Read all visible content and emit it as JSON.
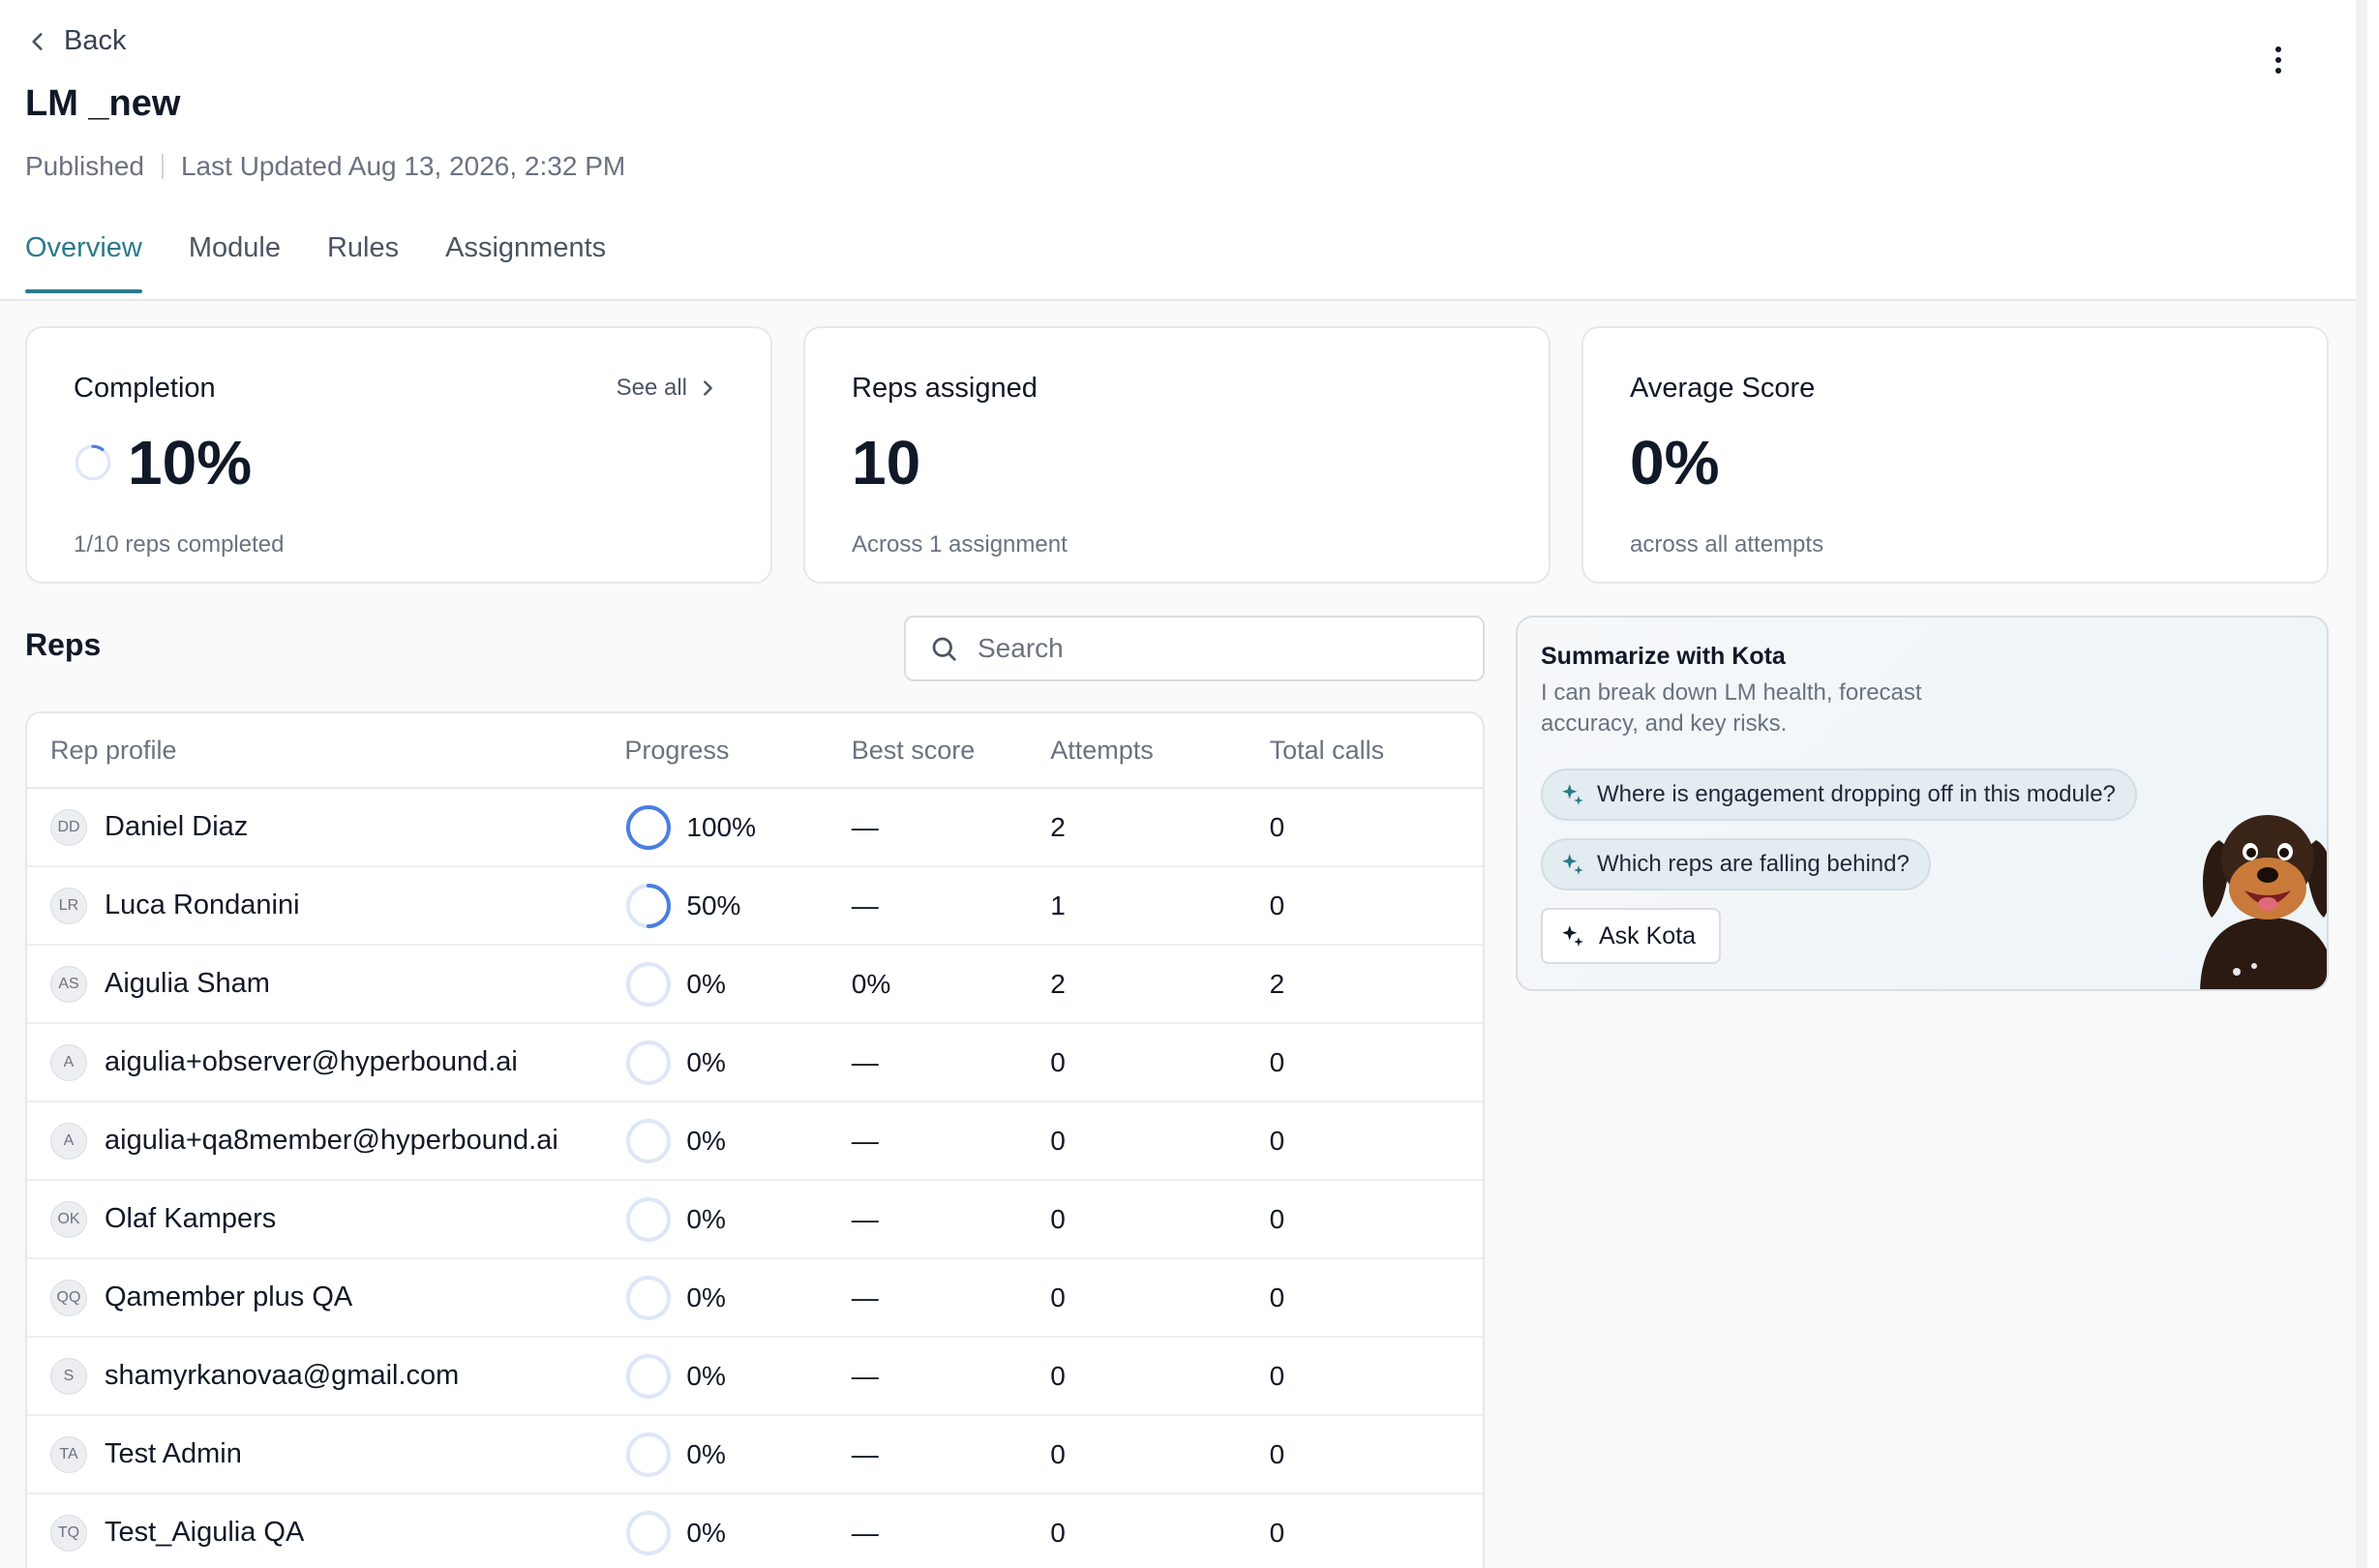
{
  "header": {
    "back_label": "Back",
    "title": "LM _new",
    "status": "Published",
    "last_updated": "Last Updated Aug 13, 2026, 2:32 PM"
  },
  "tabs": [
    {
      "label": "Overview",
      "active": true
    },
    {
      "label": "Module",
      "active": false
    },
    {
      "label": "Rules",
      "active": false
    },
    {
      "label": "Assignments",
      "active": false
    }
  ],
  "cards": {
    "completion": {
      "title": "Completion",
      "see_all": "See all",
      "value": "10%",
      "fraction": 0.1,
      "sub": "1/10 reps completed"
    },
    "reps_assigned": {
      "title": "Reps assigned",
      "value": "10",
      "sub": "Across 1 assignment"
    },
    "average_score": {
      "title": "Average Score",
      "value": "0%",
      "sub": "across all attempts"
    }
  },
  "reps": {
    "title": "Reps",
    "search_placeholder": "Search",
    "columns": [
      "Rep profile",
      "Progress",
      "Best score",
      "Attempts",
      "Total calls"
    ],
    "rows": [
      {
        "initials": "DD",
        "name": "Daniel Diaz",
        "progress": "100%",
        "progress_fraction": 1.0,
        "best_score": "—",
        "attempts": "2",
        "total_calls": "0"
      },
      {
        "initials": "LR",
        "name": "Luca Rondanini",
        "progress": "50%",
        "progress_fraction": 0.5,
        "best_score": "—",
        "attempts": "1",
        "total_calls": "0"
      },
      {
        "initials": "AS",
        "name": "Aigulia Sham",
        "progress": "0%",
        "progress_fraction": 0,
        "best_score": "0%",
        "attempts": "2",
        "total_calls": "2"
      },
      {
        "initials": "A",
        "name": "aigulia+observer@hyperbound.ai",
        "progress": "0%",
        "progress_fraction": 0,
        "best_score": "—",
        "attempts": "0",
        "total_calls": "0"
      },
      {
        "initials": "A",
        "name": "aigulia+qa8member@hyperbound.ai",
        "progress": "0%",
        "progress_fraction": 0,
        "best_score": "—",
        "attempts": "0",
        "total_calls": "0"
      },
      {
        "initials": "OK",
        "name": "Olaf Kampers",
        "progress": "0%",
        "progress_fraction": 0,
        "best_score": "—",
        "attempts": "0",
        "total_calls": "0"
      },
      {
        "initials": "QQ",
        "name": "Qamember plus QA",
        "progress": "0%",
        "progress_fraction": 0,
        "best_score": "—",
        "attempts": "0",
        "total_calls": "0"
      },
      {
        "initials": "S",
        "name": "shamyrkanovaa@gmail.com",
        "progress": "0%",
        "progress_fraction": 0,
        "best_score": "—",
        "attempts": "0",
        "total_calls": "0"
      },
      {
        "initials": "TA",
        "name": "Test Admin",
        "progress": "0%",
        "progress_fraction": 0,
        "best_score": "—",
        "attempts": "0",
        "total_calls": "0"
      },
      {
        "initials": "TQ",
        "name": "Test_Aigulia QA",
        "progress": "0%",
        "progress_fraction": 0,
        "best_score": "—",
        "attempts": "0",
        "total_calls": "0"
      }
    ]
  },
  "kota": {
    "title": "Summarize with Kota",
    "description": "I can break down LM health, forecast accuracy, and key risks.",
    "suggestions": [
      "Where is engagement dropping off in this module?",
      "Which reps are falling behind?"
    ],
    "ask_label": "Ask Kota"
  },
  "colors": {
    "accent": "#2b7a8c",
    "progress": "#4a7fe0",
    "progress_track": "#dfe6f7"
  }
}
